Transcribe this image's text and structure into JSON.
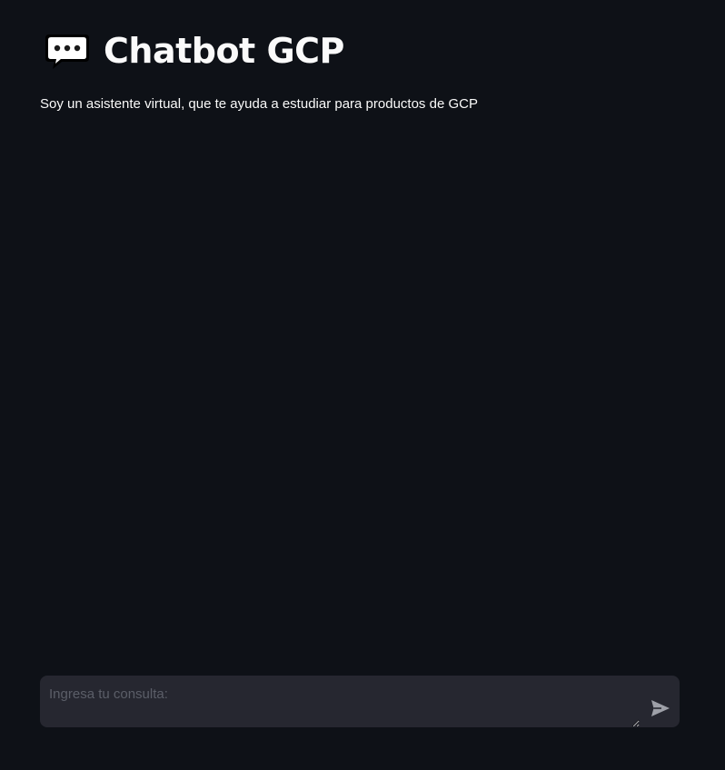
{
  "header": {
    "icon": "speech-balloon-icon",
    "title": "Chatbot GCP"
  },
  "subtitle": "Soy un asistente virtual, que te ayuda a estudiar para productos de GCP",
  "chat_input": {
    "placeholder": "Ingresa tu consulta:",
    "value": "",
    "send_icon": "send-icon"
  },
  "colors": {
    "background": "#0e1117",
    "input_background": "#262730",
    "text": "#fafafa",
    "placeholder": "#5b5e68",
    "send_icon": "#9ea0a8"
  }
}
